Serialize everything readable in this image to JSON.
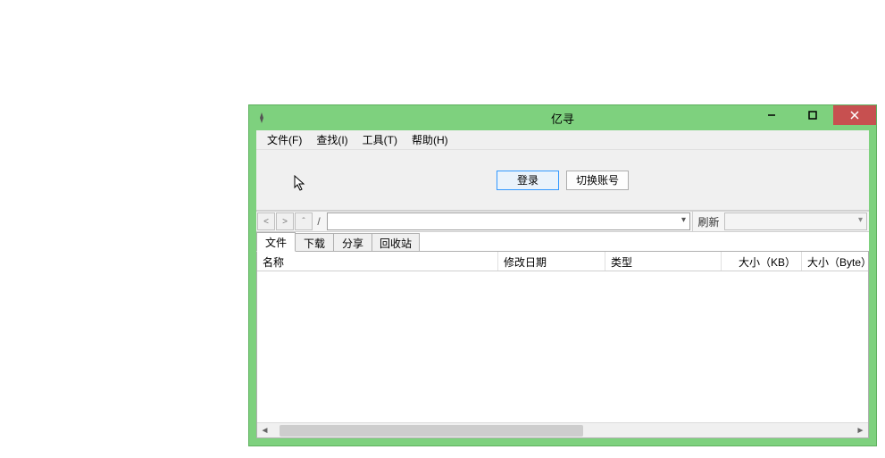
{
  "window": {
    "title": "亿寻"
  },
  "menu": {
    "file": "文件(F)",
    "find": "查找(I)",
    "tools": "工具(T)",
    "help": "帮助(H)"
  },
  "login": {
    "login_btn": "登录",
    "switch_account_btn": "切换账号"
  },
  "nav": {
    "back": "<",
    "forward": ">",
    "up": "ˆ",
    "slash": "/",
    "path": "",
    "refresh": "刷新",
    "search": ""
  },
  "tabs": {
    "files": "文件",
    "downloads": "下载",
    "share": "分享",
    "recycle": "回收站"
  },
  "columns": {
    "name": "名称",
    "modified": "修改日期",
    "type": "类型",
    "size_kb": "大小（KB）",
    "size_byte": "大小（Byte）"
  }
}
